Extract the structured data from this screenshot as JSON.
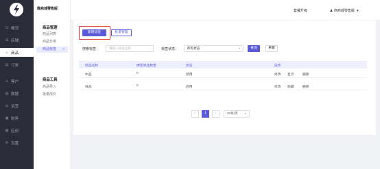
{
  "nav": {
    "items": [
      {
        "label": "概况",
        "icon": "overview-icon",
        "glyph": "⊡"
      },
      {
        "label": "店铺",
        "icon": "store-icon",
        "glyph": "⊞"
      },
      {
        "label": "商品",
        "icon": "goods-icon",
        "glyph": "⌂"
      },
      {
        "label": "订单",
        "icon": "order-icon",
        "glyph": "▤"
      },
      {
        "label": "客户",
        "icon": "customer-icon",
        "glyph": "♙"
      },
      {
        "label": "数据",
        "icon": "data-icon",
        "glyph": "▥"
      },
      {
        "label": "运营",
        "icon": "operation-icon",
        "glyph": "◎"
      },
      {
        "label": "财务",
        "icon": "finance-icon",
        "glyph": "▣"
      },
      {
        "label": "应用",
        "icon": "apps-icon",
        "glyph": "▦"
      },
      {
        "label": "设置",
        "icon": "settings-icon",
        "glyph": "⚙"
      }
    ],
    "active_index": 2
  },
  "sub": {
    "brand": "微商城零售版",
    "group1": {
      "title": "商品管理",
      "items": [
        "商品列表",
        "商品分类",
        "商品标签"
      ]
    },
    "group2": {
      "title": "商品工具",
      "items": [
        "商品导入",
        "批量改价"
      ]
    },
    "active_item": "商品标签"
  },
  "topbar": {
    "package_link": "套餐升级",
    "user_name": "商商城零售版",
    "user_icon": "user-icon",
    "caret": "▾"
  },
  "toolbar": {
    "new_tag": "新建标签",
    "batch_manage": "批量管理"
  },
  "filters": {
    "search_label": "搜索标签：",
    "search_placeholder": "请输入标签名称",
    "status_label": "标签状态：",
    "status_value": "所有状态",
    "search_button": "查询",
    "reset_button": "重置"
  },
  "table": {
    "columns": [
      "标签名称",
      "绑定商品数量",
      "状态",
      "操作"
    ],
    "rows": [
      {
        "name": "中品",
        "count": "0",
        "status": "禁用",
        "ops": [
          "修改",
          "显示",
          "删除"
        ]
      },
      {
        "name": "低品",
        "count": "0",
        "status": "启用",
        "ops": [
          "修改",
          "隐藏",
          "删除"
        ]
      }
    ]
  },
  "pagination": {
    "prev": "‹",
    "current": "1",
    "next": "›",
    "page_size": "20条/页"
  },
  "colors": {
    "accent": "#5b5bd9",
    "danger": "#e03b3b",
    "nav_bg": "#2a2c37"
  }
}
